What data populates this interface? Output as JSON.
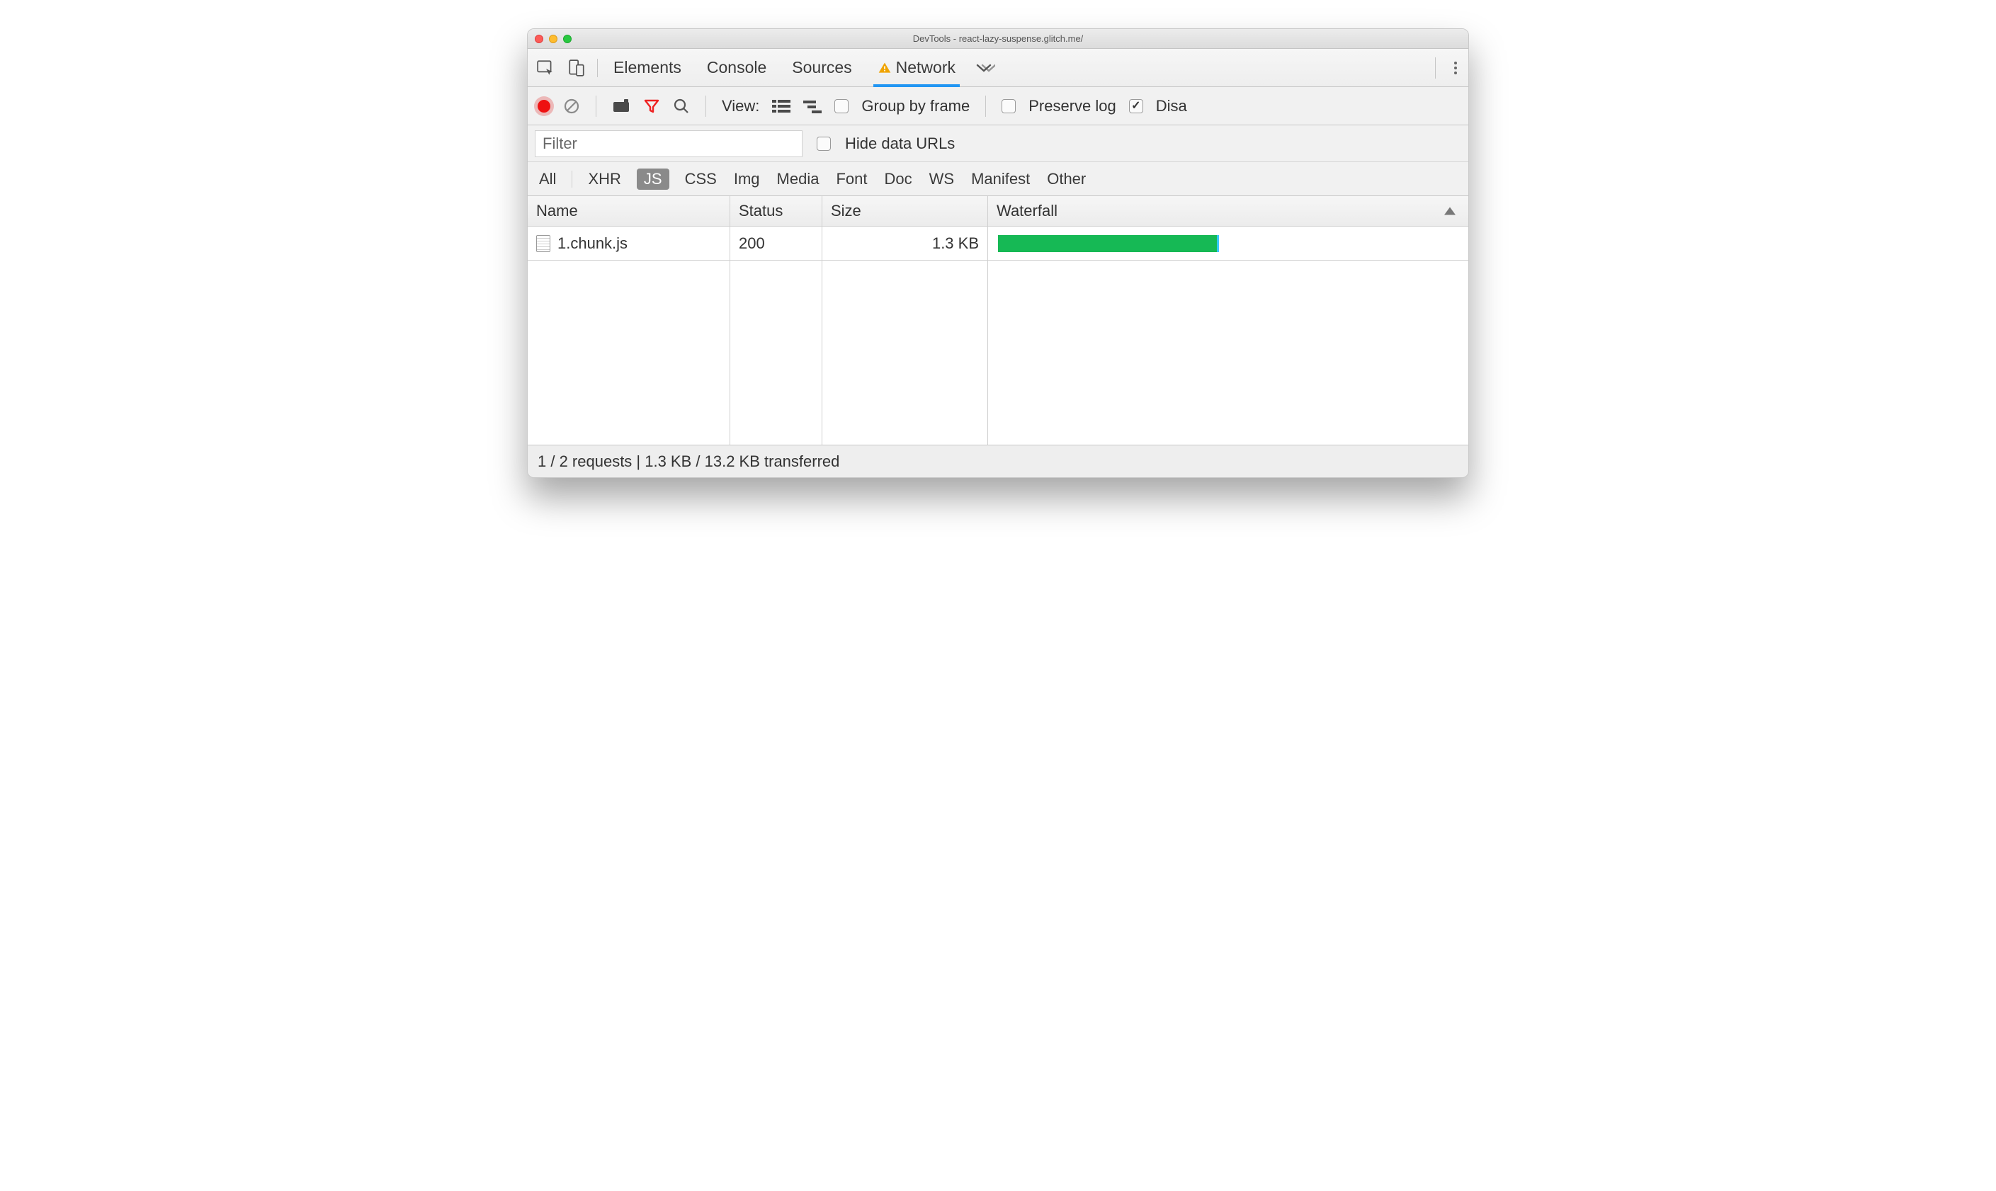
{
  "window": {
    "title": "DevTools - react-lazy-suspense.glitch.me/"
  },
  "tabs": {
    "items": [
      "Elements",
      "Console",
      "Sources",
      "Network"
    ],
    "selected": "Network"
  },
  "toolbar": {
    "view_label": "View:",
    "group_by_frame_label": "Group by frame",
    "preserve_log_label": "Preserve log",
    "disable_cache_label": "Disa",
    "group_by_frame_checked": false,
    "preserve_log_checked": false,
    "disable_cache_checked": true
  },
  "filter": {
    "placeholder": "Filter",
    "hide_data_urls_label": "Hide data URLs",
    "hide_data_urls_checked": false
  },
  "types": {
    "items": [
      "All",
      "XHR",
      "JS",
      "CSS",
      "Img",
      "Media",
      "Font",
      "Doc",
      "WS",
      "Manifest",
      "Other"
    ],
    "selected": "JS"
  },
  "table": {
    "columns": {
      "name": "Name",
      "status": "Status",
      "size": "Size",
      "waterfall": "Waterfall"
    },
    "rows": [
      {
        "name": "1.chunk.js",
        "status": "200",
        "size": "1.3 KB",
        "waterfall_pct": 48
      }
    ]
  },
  "status": {
    "summary": "1 / 2 requests | 1.3 KB / 13.2 KB transferred"
  }
}
